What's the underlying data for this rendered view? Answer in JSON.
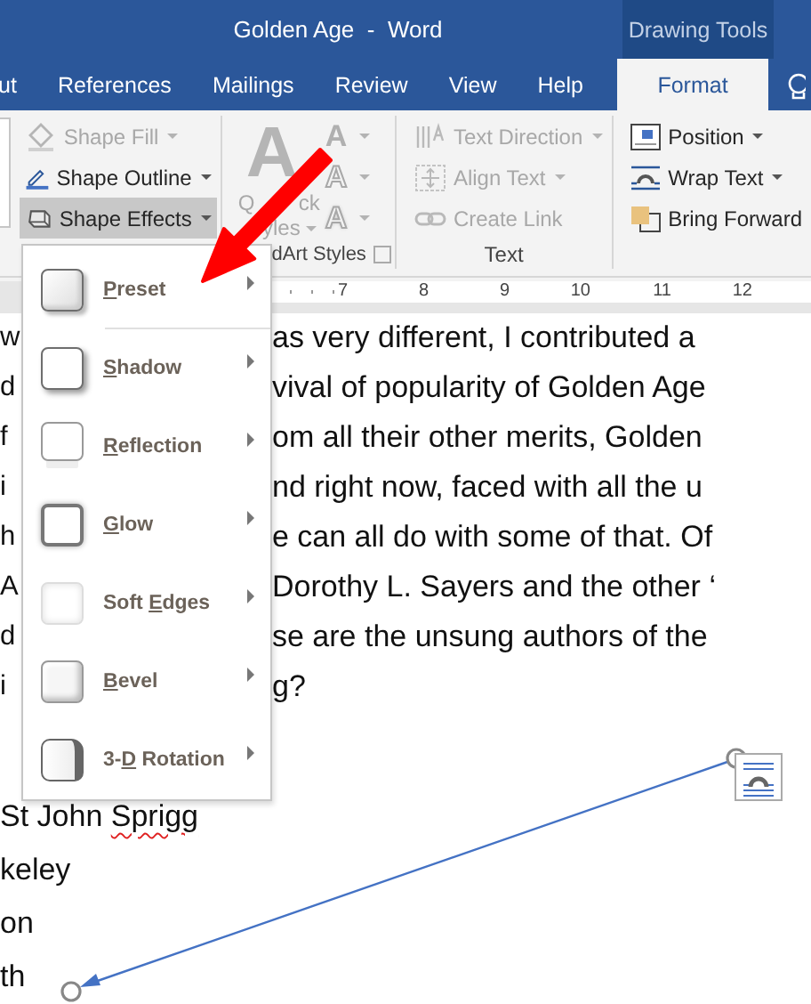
{
  "window": {
    "title": "Golden Age  -  Word",
    "context_header": "Drawing Tools"
  },
  "tabs": [
    {
      "label": "ut",
      "selected": false,
      "contextual": false
    },
    {
      "label": "References",
      "selected": false,
      "contextual": false
    },
    {
      "label": "Mailings",
      "selected": false,
      "contextual": false
    },
    {
      "label": "Review",
      "selected": false,
      "contextual": false
    },
    {
      "label": "View",
      "selected": false,
      "contextual": false
    },
    {
      "label": "Help",
      "selected": false,
      "contextual": false
    },
    {
      "label": "Format",
      "selected": true,
      "contextual": true
    }
  ],
  "ribbon": {
    "shape_styles": {
      "buttons": [
        {
          "label": "Shape Fill",
          "disabled": true,
          "pressed": false,
          "dropdown": true
        },
        {
          "label": "Shape Outline",
          "disabled": false,
          "pressed": false,
          "dropdown": true
        },
        {
          "label": "Shape Effects",
          "disabled": false,
          "pressed": true,
          "dropdown": true
        }
      ]
    },
    "wordart": {
      "label": "dArt Styles",
      "quick_styles": {
        "glyph": "A",
        "label_lines": [
          [
            "Q",
            "ck"
          ],
          [
            "yles"
          ]
        ],
        "disabled": true
      },
      "glyphs": [
        {
          "glyph": "A",
          "kind": "fill"
        },
        {
          "glyph": "A",
          "kind": "outline"
        },
        {
          "glyph": "A",
          "kind": "effects"
        }
      ]
    },
    "text": {
      "label": "Text",
      "buttons": [
        {
          "label": "Text Direction",
          "disabled": true,
          "dropdown": true
        },
        {
          "label": "Align Text",
          "disabled": true,
          "dropdown": true
        },
        {
          "label": "Create Link",
          "disabled": true,
          "dropdown": false
        }
      ]
    },
    "arrange": {
      "buttons": [
        {
          "label": "Position",
          "disabled": false,
          "dropdown": true
        },
        {
          "label": "Wrap Text",
          "disabled": false,
          "dropdown": true
        },
        {
          "label": "Bring Forward",
          "disabled": false,
          "dropdown": false
        }
      ]
    }
  },
  "ruler": {
    "marks": [
      "7",
      "8",
      "9",
      "10",
      "11",
      "12"
    ]
  },
  "document": {
    "lines": [
      {
        "left": "w",
        "right": "as very different, I contributed a"
      },
      {
        "left": "d",
        "right": "vival of popularity of Golden Age"
      },
      {
        "left": "f",
        "right": "om all their other merits, Golden"
      },
      {
        "left": "i",
        "right": "nd right now, faced with all the u"
      },
      {
        "left": "h",
        "right": "e can all do with some of that. Of"
      },
      {
        "left": "A",
        "right": "Dorothy L. Sayers and the other ‘"
      },
      {
        "left": "d",
        "right": "se are the unsung authors of the"
      },
      {
        "left": "i",
        "right": "g?"
      }
    ],
    "list": [
      {
        "text": "St John ",
        "misspelled": "Sprigg"
      },
      {
        "text": "keley"
      },
      {
        "text": "on"
      },
      {
        "text": "th"
      }
    ]
  },
  "effects_menu": {
    "items": [
      {
        "kind": "preset",
        "label": {
          "key": "P",
          "after": "reset"
        },
        "has_submenu": true
      },
      {
        "kind": "shadow",
        "label": {
          "key": "S",
          "after": "hadow"
        },
        "has_submenu": true
      },
      {
        "kind": "reflection",
        "label": {
          "key": "R",
          "after": "eflection"
        },
        "has_submenu": true
      },
      {
        "kind": "glow",
        "label": {
          "key": "G",
          "after": "low"
        },
        "has_submenu": true
      },
      {
        "kind": "soft_edges",
        "label": {
          "before": "Soft ",
          "key": "E",
          "after": "dges"
        },
        "has_submenu": true
      },
      {
        "kind": "bevel",
        "label": {
          "key": "B",
          "after": "evel"
        },
        "has_submenu": true
      },
      {
        "kind": "rotation_3d",
        "label": {
          "before": "3-",
          "key": "D",
          "after": " Rotation"
        },
        "has_submenu": true
      }
    ]
  }
}
